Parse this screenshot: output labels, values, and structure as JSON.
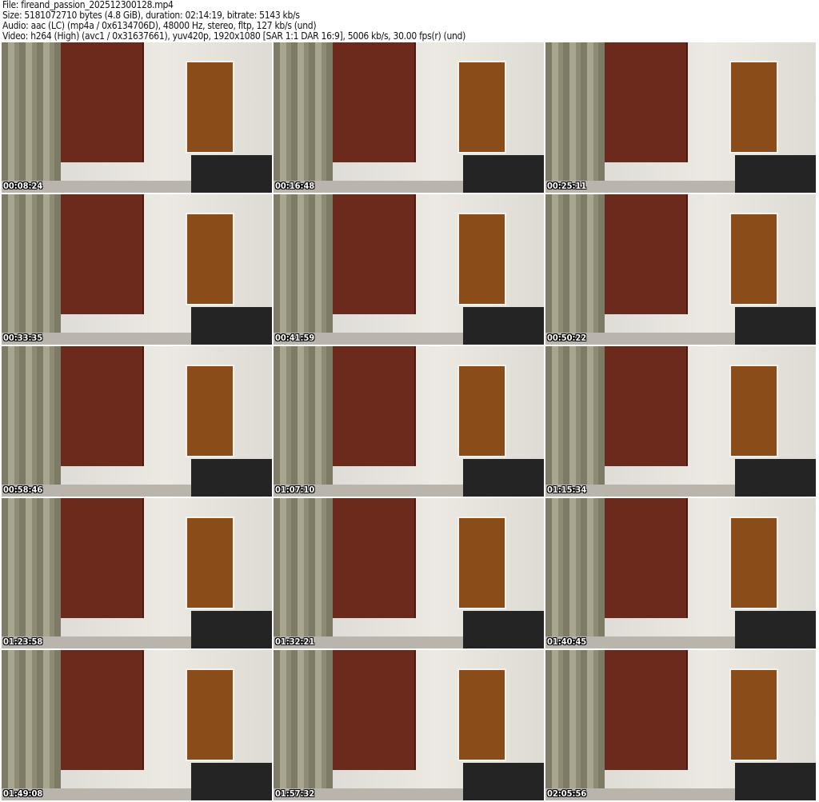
{
  "header": {
    "file": "File: fireand_passion_202512300128.mp4",
    "size": "Size: 5181072710 bytes (4.8 GiB), duration: 02:14:19, bitrate: 5143 kb/s",
    "audio": "Audio: aac (LC) (mp4a / 0x6134706D), 48000 Hz, stereo, fltp, 127 kb/s (und)",
    "video": "Video: h264 (High) (avc1 / 0x31637661), yuv420p, 1920x1080 [SAR 1:1 DAR 16:9], 5006 kb/s, 30.00 fps(r) (und)"
  },
  "thumbnails": [
    {
      "timestamp": "00:08:24"
    },
    {
      "timestamp": "00:16:48"
    },
    {
      "timestamp": "00:25:11"
    },
    {
      "timestamp": "00:33:35"
    },
    {
      "timestamp": "00:41:59"
    },
    {
      "timestamp": "00:50:22"
    },
    {
      "timestamp": "00:58:46"
    },
    {
      "timestamp": "01:07:10"
    },
    {
      "timestamp": "01:15:34"
    },
    {
      "timestamp": "01:23:58"
    },
    {
      "timestamp": "01:32:21"
    },
    {
      "timestamp": "01:40:45"
    },
    {
      "timestamp": "01:49:08"
    },
    {
      "timestamp": "01:57:32"
    },
    {
      "timestamp": "02:05:56"
    }
  ]
}
